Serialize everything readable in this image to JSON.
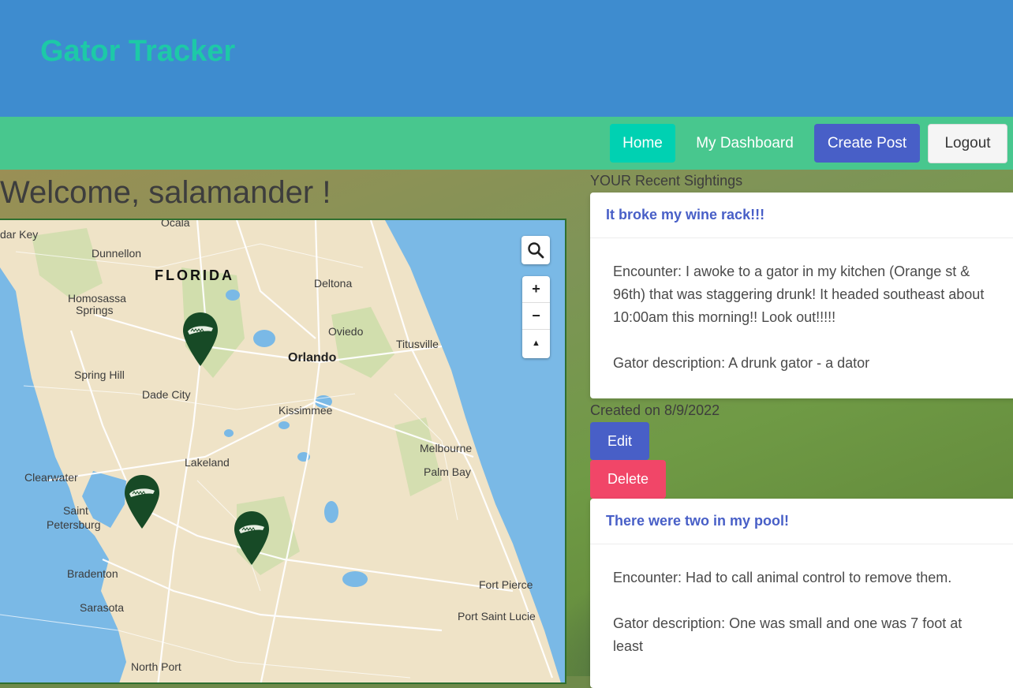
{
  "header": {
    "brand": "Gator Tracker"
  },
  "nav": {
    "home": "Home",
    "dashboard": "My Dashboard",
    "create_post": "Create Post",
    "logout": "Logout"
  },
  "welcome": "Welcome, salamander !",
  "map": {
    "state_label": "FLORIDA",
    "labels": {
      "cedar_key": "dar Key",
      "ocala": "Ocala",
      "dunnellon": "Dunnellon",
      "deltona": "Deltona",
      "homosassa": "Homosassa",
      "springs": "Springs",
      "oviedo": "Oviedo",
      "titusville": "Titusville",
      "orlando": "Orlando",
      "spring_hill": "Spring Hill",
      "dade_city": "Dade City",
      "kissimmee": "Kissimmee",
      "melbourne": "Melbourne",
      "lakeland": "Lakeland",
      "palm_bay": "Palm Bay",
      "clearwater": "Clearwater",
      "saint": "Saint",
      "petersburg": "Petersburg",
      "bradenton": "Bradenton",
      "fort_pierce": "Fort Pierce",
      "sarasota": "Sarasota",
      "port_saint_lucie": "Port Saint Lucie",
      "north_port": "North Port"
    },
    "search_icon": "search-icon",
    "zoom_in": "+",
    "zoom_out": "−",
    "compass": "▲",
    "colors": {
      "land": "#efe3c7",
      "water": "#7ab9e6",
      "park": "#c9dca6",
      "pin": "#174a26"
    }
  },
  "sightings": {
    "section_title": "YOUR Recent Sightings",
    "posts": [
      {
        "title": "It broke my wine rack!!!",
        "encounter": "Encounter: I awoke to a gator in my kitchen (Orange st & 96th) that was staggering drunk! It headed southeast about 10:00am this morning!! Look out!!!!!",
        "description": "Gator description: A drunk gator - a dator",
        "created": "Created on 8/9/2022",
        "edit_label": "Edit",
        "delete_label": "Delete"
      },
      {
        "title": "There were two in my pool!",
        "encounter": "Encounter: Had to call animal control to remove them.",
        "description": "Gator description: One was small and one was 7 foot at least"
      }
    ]
  }
}
